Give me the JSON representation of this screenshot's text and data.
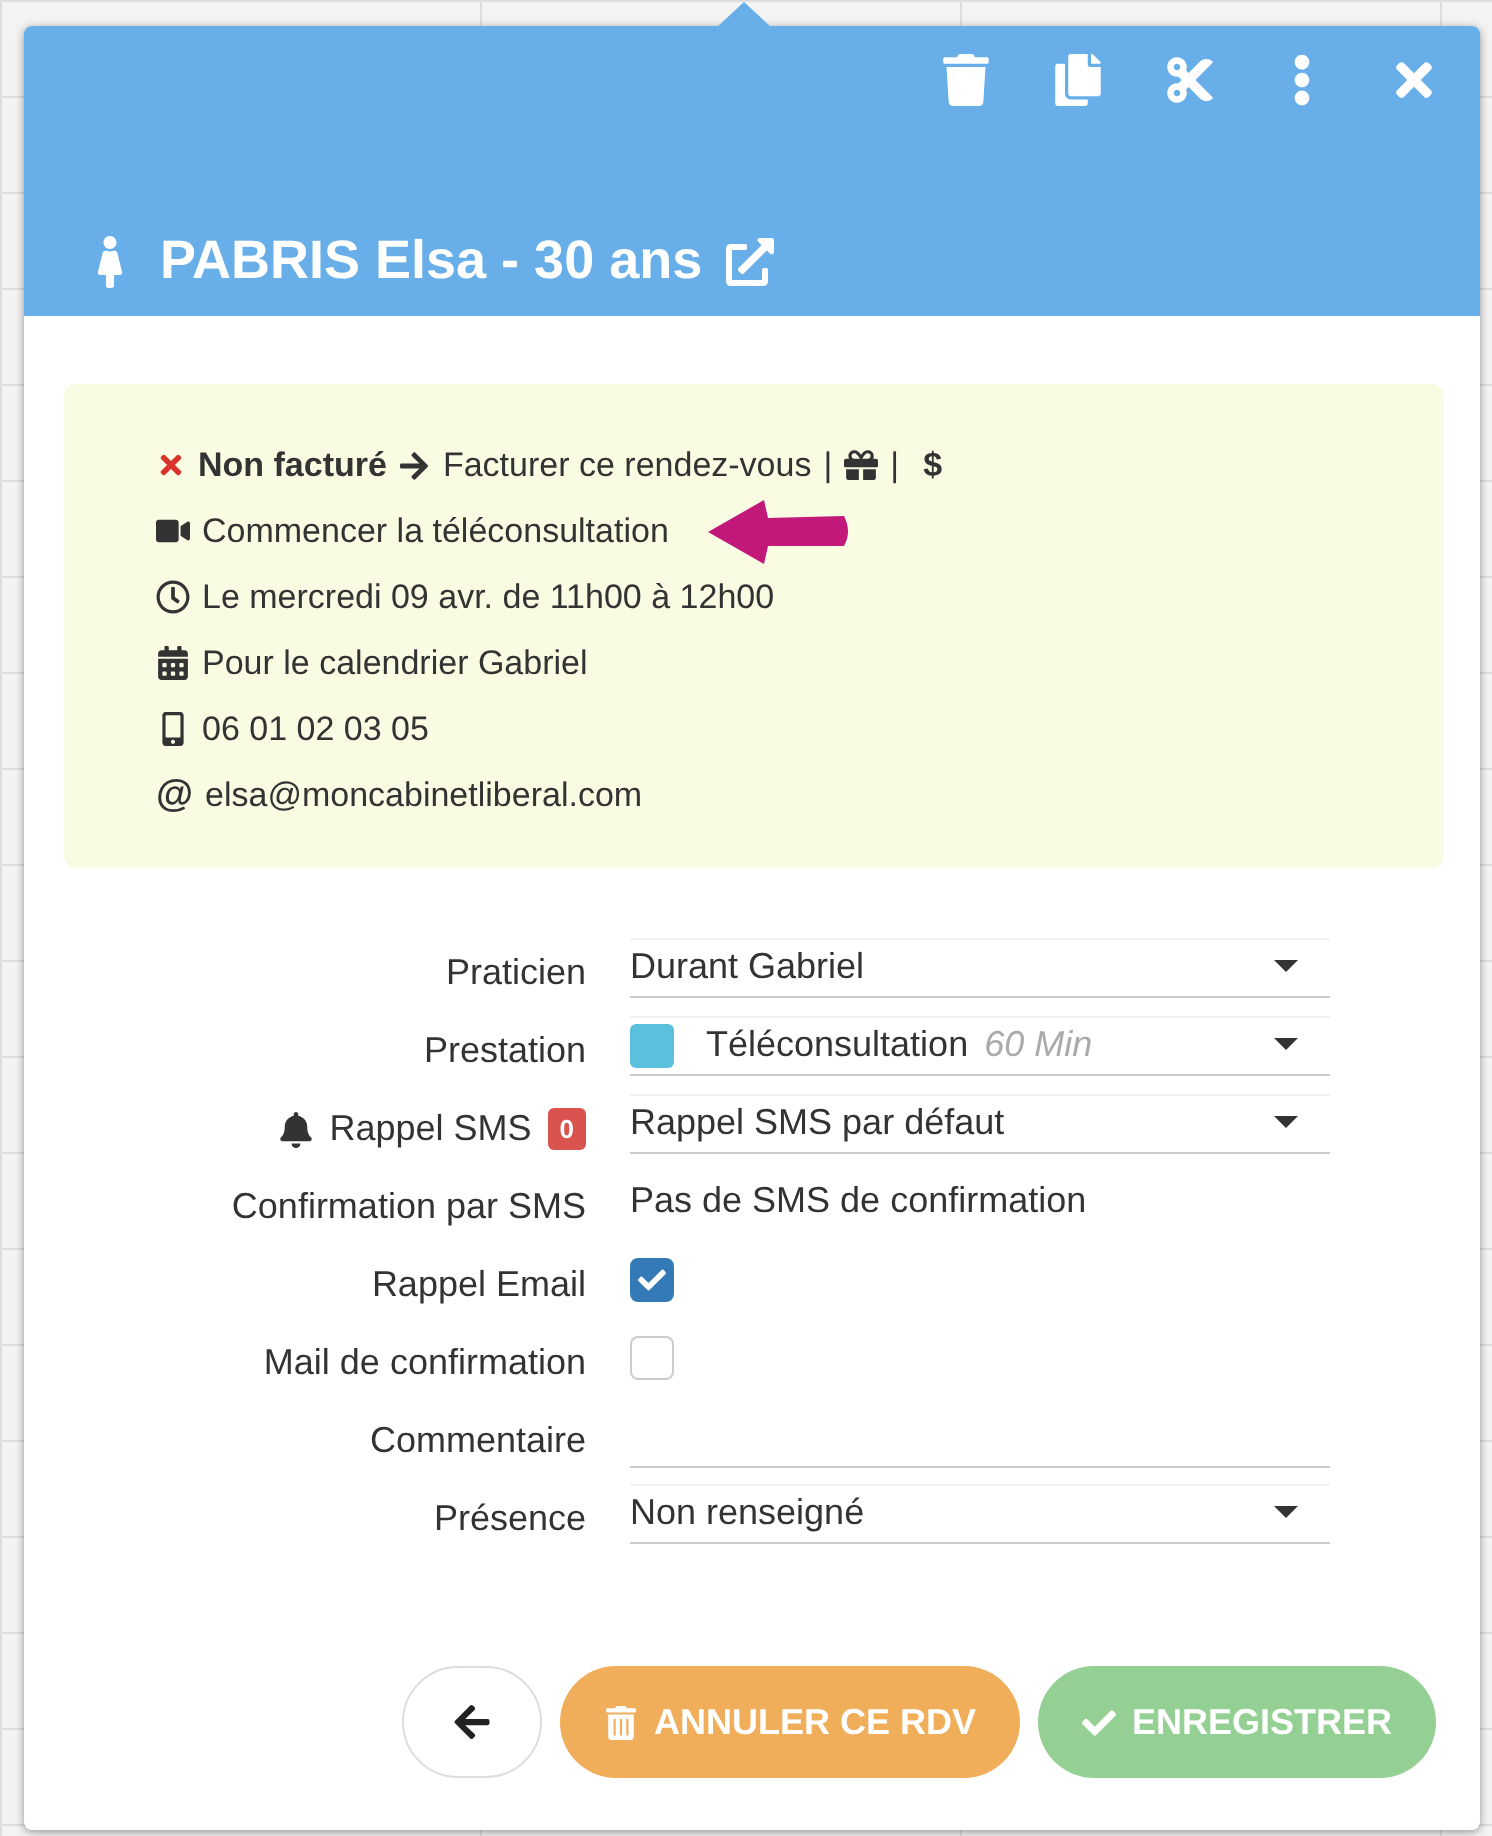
{
  "header": {
    "title": "PABRIS Elsa - 30 ans"
  },
  "billing": {
    "status": "Non facturé",
    "action": "Facturer ce rendez-vous",
    "separators": [
      "|",
      "|"
    ],
    "currency": "$"
  },
  "info": [
    {
      "kind": "video",
      "text": "Commencer la téléconsultation",
      "highlighted": true
    },
    {
      "kind": "clock",
      "text": "Le mercredi 09 avr. de 11h00 à 12h00"
    },
    {
      "kind": "calendar",
      "text": "Pour le calendrier Gabriel"
    },
    {
      "kind": "phone",
      "text": "06 01 02 03 05"
    },
    {
      "kind": "email",
      "symbol": "@",
      "text": "elsa@moncabinetliberal.com"
    }
  ],
  "fields": [
    {
      "kind": "select",
      "label": "Praticien",
      "value": "Durant Gabriel"
    },
    {
      "kind": "select",
      "label": "Prestation",
      "value": "Téléconsultation",
      "detail": "60 Min",
      "color": "#5bc0de"
    },
    {
      "kind": "reminder",
      "label": "Rappel SMS",
      "badge": "0",
      "value": "Rappel SMS par défaut"
    },
    {
      "kind": "text",
      "label": "Confirmation par SMS",
      "value": "Pas de SMS de confirmation"
    },
    {
      "kind": "checkbox",
      "label": "Rappel Email",
      "checked": true
    },
    {
      "kind": "checkbox",
      "label": "Mail de confirmation",
      "checked": false
    },
    {
      "kind": "input",
      "label": "Commentaire"
    },
    {
      "kind": "select",
      "label": "Présence",
      "value": "Non renseigné"
    }
  ],
  "buttons": [
    {
      "kind": "back"
    },
    {
      "kind": "cancel",
      "label": "ANNULER CE RDV"
    },
    {
      "kind": "save",
      "label": "ENREGISTRER",
      "disabled": true
    }
  ]
}
